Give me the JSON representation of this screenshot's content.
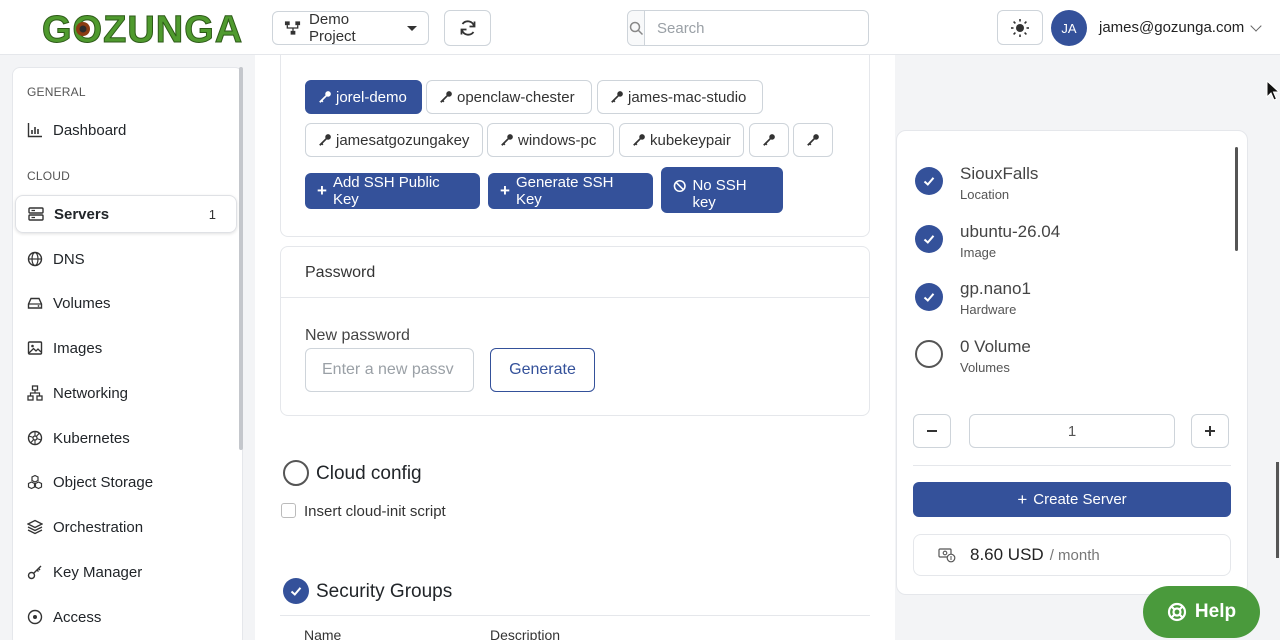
{
  "header": {
    "logo_text": "GOZUNGA",
    "project_label": "Demo Project",
    "search_placeholder": "Search",
    "avatar_initials": "JA",
    "user_email": "james@gozunga.com"
  },
  "sidebar": {
    "sections": [
      {
        "label": "GENERAL",
        "items": [
          {
            "label": "Dashboard",
            "icon": "chart-icon"
          }
        ]
      },
      {
        "label": "CLOUD",
        "items": [
          {
            "label": "Servers",
            "icon": "server-icon",
            "count": "1",
            "active": true
          },
          {
            "label": "DNS",
            "icon": "globe-icon"
          },
          {
            "label": "Volumes",
            "icon": "drive-icon"
          },
          {
            "label": "Images",
            "icon": "image-icon"
          },
          {
            "label": "Networking",
            "icon": "network-icon"
          },
          {
            "label": "Kubernetes",
            "icon": "kubernetes-icon"
          },
          {
            "label": "Object Storage",
            "icon": "boxes-icon"
          },
          {
            "label": "Orchestration",
            "icon": "layers-icon"
          },
          {
            "label": "Key Manager",
            "icon": "key-icon"
          },
          {
            "label": "Access",
            "icon": "access-icon"
          }
        ]
      }
    ]
  },
  "ssh": {
    "keys": [
      {
        "label": "jorel-demo",
        "selected": true
      },
      {
        "label": "openclaw-chester",
        "selected": false
      },
      {
        "label": "james-mac-studio",
        "selected": false
      },
      {
        "label": "jamesatgozungakey",
        "selected": false
      },
      {
        "label": "windows-pc",
        "selected": false
      },
      {
        "label": "kubekeypair",
        "selected": false
      },
      {
        "label": "",
        "selected": false
      },
      {
        "label": "",
        "selected": false
      }
    ],
    "add_label": "Add SSH Public Key",
    "generate_label": "Generate SSH Key",
    "no_key_label": "No SSH key"
  },
  "password": {
    "title": "Password",
    "field_label": "New password",
    "placeholder": "Enter a new passv",
    "generate_label": "Generate"
  },
  "cloud_config": {
    "title": "Cloud config",
    "checkbox_label": "Insert cloud-init script",
    "checked": false
  },
  "security_groups": {
    "title": "Security Groups",
    "columns": [
      "Name",
      "Description"
    ]
  },
  "summary": {
    "items": [
      {
        "title": "SiouxFalls",
        "subtitle": "Location",
        "done": true
      },
      {
        "title": "ubuntu-26.04",
        "subtitle": "Image",
        "done": true
      },
      {
        "title": "gp.nano1",
        "subtitle": "Hardware",
        "done": true
      },
      {
        "title": "0 Volume",
        "subtitle": "Volumes",
        "done": false
      }
    ],
    "quantity": "1",
    "create_label": "Create Server",
    "price": "8.60 USD",
    "period": "/ month"
  },
  "help_label": "Help",
  "colors": {
    "primary": "#34519a",
    "help": "#4a9a3c",
    "logo_green": "#4f9a2e"
  }
}
